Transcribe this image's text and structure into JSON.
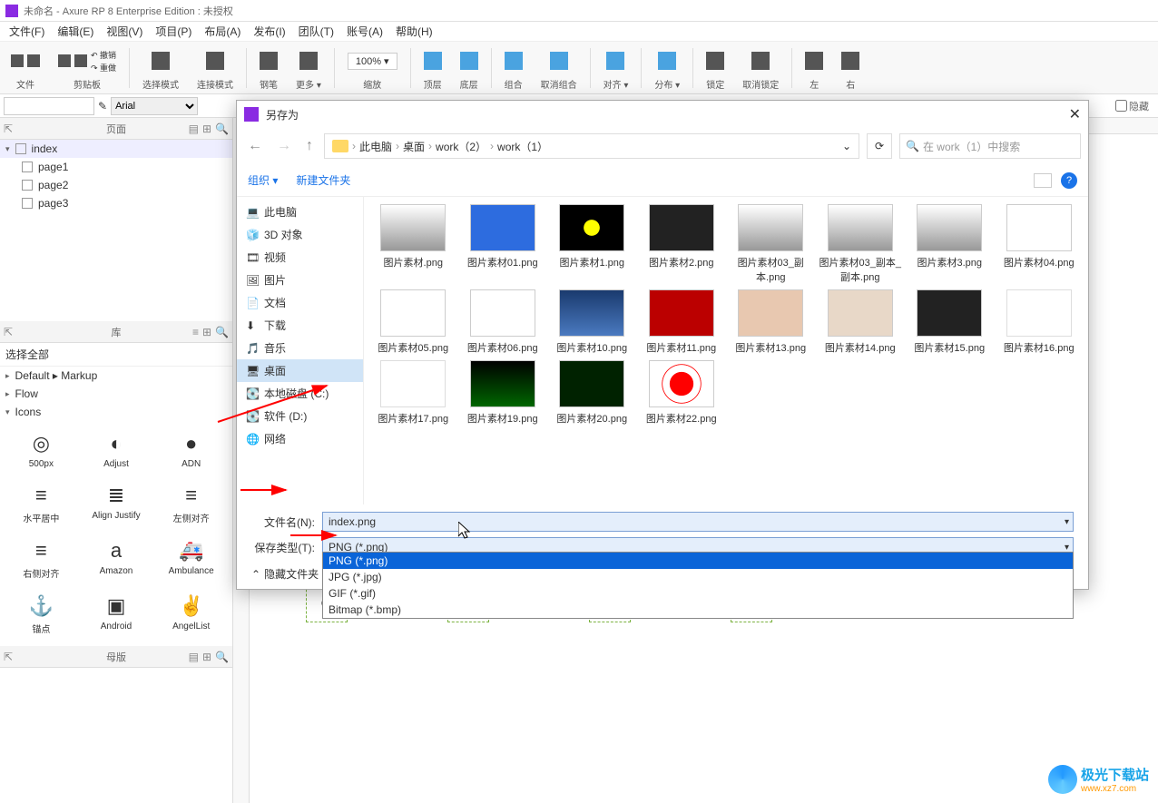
{
  "title": "未命名 - Axure RP 8 Enterprise Edition : 未授权",
  "menubar": [
    "文件(F)",
    "编辑(E)",
    "视图(V)",
    "项目(P)",
    "布局(A)",
    "发布(I)",
    "团队(T)",
    "账号(A)",
    "帮助(H)"
  ],
  "toolbar": {
    "file": "文件",
    "clipboard": "剪贴板",
    "select_mode": "选择模式",
    "connect_mode": "连接模式",
    "pen": "钢笔",
    "more": "更多 ▾",
    "zoom": "100% ▾",
    "zoom_label": "缩放",
    "top": "顶层",
    "bottom": "底层",
    "group": "组合",
    "ungroup": "取消组合",
    "align": "对齐 ▾",
    "distribute": "分布 ▾",
    "lock": "锁定",
    "unlock": "取消锁定",
    "left": "左",
    "right": "右",
    "undo": "↶ 撤销",
    "redo": "↷ 重做"
  },
  "font_select": "Arial",
  "hidden_chk": "隐藏",
  "panels": {
    "pages": {
      "title": "页面",
      "items": [
        "index",
        "page1",
        "page2",
        "page3"
      ]
    },
    "library": {
      "title": "库",
      "filter": "选择全部",
      "groups": [
        "Default ▸ Markup",
        "Flow",
        "Icons"
      ]
    },
    "masters": {
      "title": "母版"
    }
  },
  "icons": [
    {
      "g": "◎",
      "l": "500px"
    },
    {
      "g": "◐",
      "l": "Adjust"
    },
    {
      "g": "●",
      "l": "ADN"
    },
    {
      "g": "≡",
      "l": "水平居中"
    },
    {
      "g": "≣",
      "l": "Align Justify"
    },
    {
      "g": "≡",
      "l": "左侧对齐"
    },
    {
      "g": "≡",
      "l": "右侧对齐"
    },
    {
      "g": "a",
      "l": "Amazon"
    },
    {
      "g": "🚑",
      "l": "Ambulance"
    },
    {
      "g": "⚓",
      "l": "锚点"
    },
    {
      "g": "▣",
      "l": "Android"
    },
    {
      "g": "✌",
      "l": "AngelList"
    }
  ],
  "dialog": {
    "title": "另存为",
    "breadcrumb": [
      "此电脑",
      "桌面",
      "work（2）",
      "work（1）"
    ],
    "search_placeholder": "在 work（1）中搜索",
    "organize": "组织 ▾",
    "new_folder": "新建文件夹",
    "sidebar": [
      {
        "l": "此电脑",
        "i": "💻"
      },
      {
        "l": "3D 对象",
        "i": "🧊"
      },
      {
        "l": "视频",
        "i": "🎞"
      },
      {
        "l": "图片",
        "i": "🖼"
      },
      {
        "l": "文档",
        "i": "📄"
      },
      {
        "l": "下载",
        "i": "⬇"
      },
      {
        "l": "音乐",
        "i": "🎵"
      },
      {
        "l": "桌面",
        "i": "🖥",
        "sel": true
      },
      {
        "l": "本地磁盘 (C:)",
        "i": "💽"
      },
      {
        "l": "软件 (D:)",
        "i": "💽"
      },
      {
        "l": "网络",
        "i": "🌐"
      }
    ],
    "files": [
      {
        "n": "图片素材.png",
        "c": "c4"
      },
      {
        "n": "图片素材01.png",
        "c": "c1"
      },
      {
        "n": "图片素材1.png",
        "c": "c2"
      },
      {
        "n": "图片素材2.png",
        "c": "c3"
      },
      {
        "n": "图片素材03_副本.png",
        "c": "c4"
      },
      {
        "n": "图片素材03_副本_副本.png",
        "c": "c4"
      },
      {
        "n": "图片素材3.png",
        "c": "c4"
      },
      {
        "n": "图片素材04.png",
        "c": "c5"
      },
      {
        "n": "图片素材05.png",
        "c": "c5"
      },
      {
        "n": "图片素材06.png",
        "c": "c6"
      },
      {
        "n": "图片素材10.png",
        "c": "c7"
      },
      {
        "n": "图片素材11.png",
        "c": "c8"
      },
      {
        "n": "图片素材13.png",
        "c": "c9"
      },
      {
        "n": "图片素材14.png",
        "c": "c10"
      },
      {
        "n": "图片素材15.png",
        "c": "c11"
      },
      {
        "n": "图片素材16.png",
        "c": "c12"
      },
      {
        "n": "图片素材17.png",
        "c": "c12"
      },
      {
        "n": "图片素材19.png",
        "c": "c13"
      },
      {
        "n": "图片素材20.png",
        "c": "c14"
      },
      {
        "n": "图片素材22.png",
        "c": "c15"
      }
    ],
    "filename_label": "文件名(N):",
    "filename_value": "index.png",
    "filetype_label": "保存类型(T):",
    "filetype_value": "PNG (*.png)",
    "filetype_options": [
      "PNG (*.png)",
      "JPG (*.jpg)",
      "GIF (*.gif)",
      "Bitmap (*.bmp)"
    ],
    "hide_folders": "隐藏文件夹"
  },
  "watermark": {
    "big": "极光下载站",
    "sm": "www.xz7.com"
  }
}
